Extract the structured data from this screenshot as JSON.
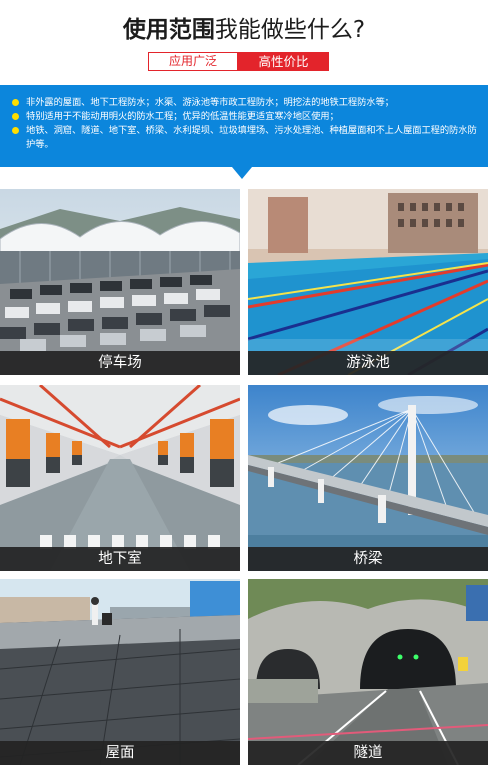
{
  "header": {
    "title_bold": "使用范围",
    "title_rest": "我能做些什么?",
    "tag_outline": "应用广泛",
    "tag_solid": "高性价比"
  },
  "banner": {
    "items": [
      "非外露的屋面、地下工程防水；水渠、游泳池等市政工程防水；明挖法的地铁工程防水等；",
      "特别适用于不能动用明火的防水工程；优异的低温性能更适宜寒冷地区使用；",
      "地铁、洞窟、隧道、地下室、桥梁、水利堤坝、垃圾填埋场、污水处理池、种植屋面和不上人屋面工程的防水防护等。"
    ],
    "colors": {
      "background": "#0c86dc",
      "bullet": "#ffde00"
    }
  },
  "gallery": [
    {
      "label": "停车场",
      "icon": "parking-lot-photo"
    },
    {
      "label": "游泳池",
      "icon": "swimming-pool-photo"
    },
    {
      "label": "地下室",
      "icon": "basement-garage-photo"
    },
    {
      "label": "桥梁",
      "icon": "bridge-photo"
    },
    {
      "label": "屋面",
      "icon": "roof-photo"
    },
    {
      "label": "隧道",
      "icon": "tunnel-photo"
    }
  ],
  "colors": {
    "accent_red": "#e3242b"
  }
}
